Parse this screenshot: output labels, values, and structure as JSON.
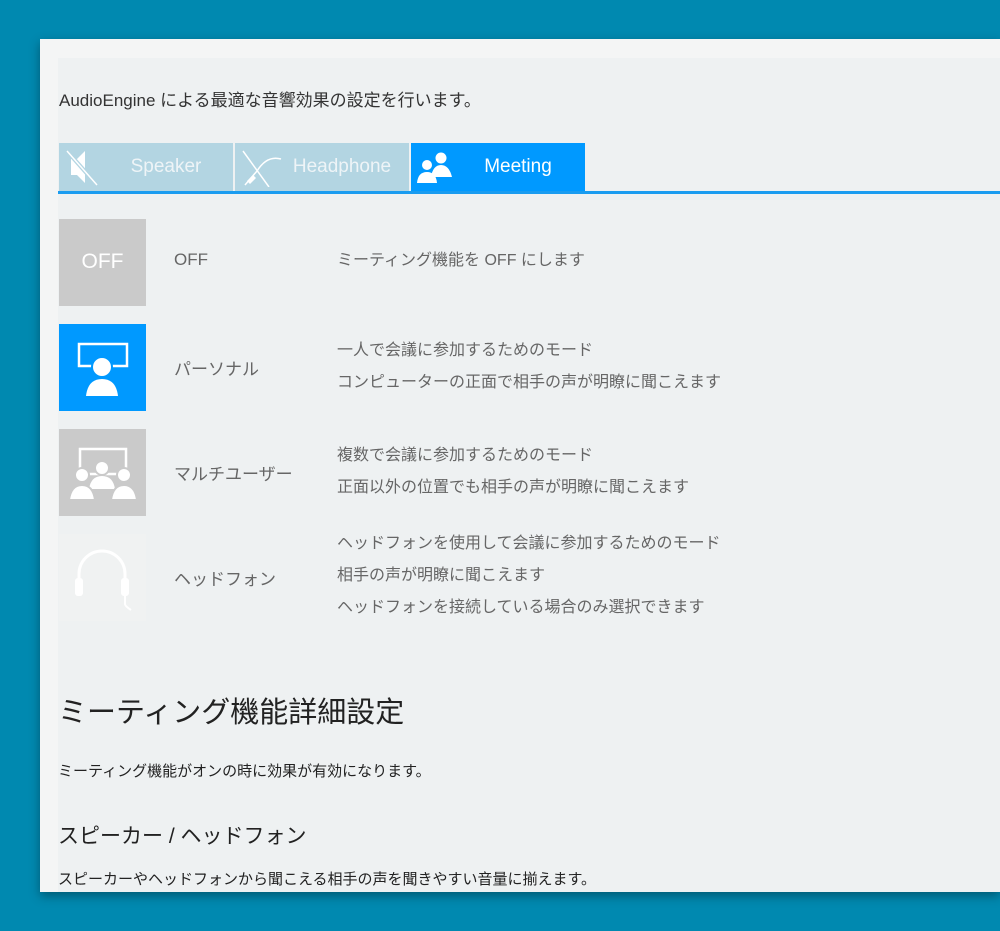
{
  "intro": "AudioEngine による最適な音響効果の設定を行います。",
  "tabs": [
    {
      "label": "Speaker",
      "icon": "speaker-muted-icon",
      "active": false
    },
    {
      "label": "Headphone",
      "icon": "headphone-muted-icon",
      "active": false
    },
    {
      "label": "Meeting",
      "icon": "people-icon",
      "active": true
    }
  ],
  "colors": {
    "accent": "#0099ff",
    "background": "#0089b0",
    "tab_inactive": "#b3d5e2",
    "tile_gray": "#cacaca"
  },
  "modes": [
    {
      "tile_text": "OFF",
      "name": "OFF",
      "lines": [
        "ミーティング機能を OFF にします"
      ],
      "state": "normal"
    },
    {
      "name": "パーソナル",
      "icon": "personal-presenter-icon",
      "lines": [
        "一人で会議に参加するためのモード",
        "コンピューターの正面で相手の声が明瞭に聞こえます"
      ],
      "state": "selected"
    },
    {
      "name": "マルチユーザー",
      "icon": "multi-user-icon",
      "lines": [
        "複数で会議に参加するためのモード",
        "正面以外の位置でも相手の声が明瞭に聞こえます"
      ],
      "state": "normal"
    },
    {
      "name": "ヘッドフォン",
      "icon": "headset-icon",
      "lines": [
        "ヘッドフォンを使用して会議に参加するためのモード",
        "相手の声が明瞭に聞こえます",
        "ヘッドフォンを接続している場合のみ選択できます"
      ],
      "state": "disabled"
    }
  ],
  "details": {
    "title": "ミーティング機能詳細設定",
    "note": "ミーティング機能がオンの時に効果が有効になります。",
    "section_title": "スピーカー / ヘッドフォン",
    "section_desc": "スピーカーやヘッドフォンから聞こえる相手の声を聞きやすい音量に揃えます。"
  }
}
